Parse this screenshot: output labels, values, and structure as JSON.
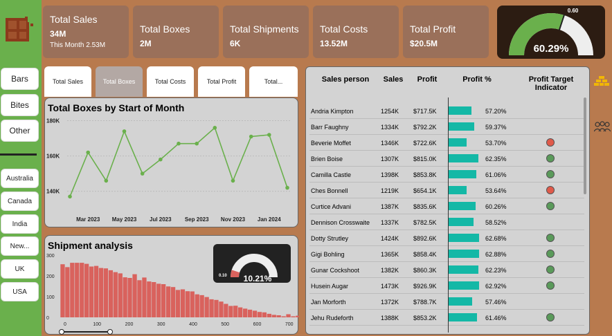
{
  "colors": {
    "green": "#6ab04c",
    "brown": "#b87a4e",
    "kpi": "#9a705a",
    "teal": "#14b8a6",
    "red_dot": "#e05a4a",
    "green_dot": "#5a9a5a",
    "bar_red": "#d9625d",
    "line": "#6ab04c"
  },
  "sidebar": {
    "logo_icon": "chocolate-icon",
    "products": [
      "Bars",
      "Bites",
      "Other"
    ],
    "countries": [
      "Australia",
      "Canada",
      "India",
      "New...",
      "UK",
      "USA"
    ]
  },
  "kpis": [
    {
      "title": "Total Sales",
      "value": "34M",
      "sub": "This Month 2.53M"
    },
    {
      "title": "Total Boxes",
      "value": "2M"
    },
    {
      "title": "Total Shipments",
      "value": "6K"
    },
    {
      "title": "Total Costs",
      "value": "13.52M"
    },
    {
      "title": "Total Profit",
      "value": "$20.5M"
    }
  ],
  "profit_gauge": {
    "value_label": "60.29%",
    "target_label": "0.60",
    "value": 0.6029,
    "target": 0.6
  },
  "tabs": [
    "Total Sales",
    "Total Boxes",
    "Total Costs",
    "Total Profit",
    "Total..."
  ],
  "line_chart": {
    "title": "Total Boxes by Start of Month"
  },
  "shipment": {
    "title": "Shipment analysis",
    "gauge_value_label": "10.21%",
    "gauge_target_label": "0.10",
    "gauge_value": 0.1021
  },
  "table": {
    "headers": [
      "Sales person",
      "Sales",
      "Profit",
      "Profit %",
      "Profit Target Indicator"
    ],
    "rows": [
      {
        "name": "Andria Kimpton",
        "sales": "1254K",
        "profit": "$717.5K",
        "pct": "57.20%",
        "p": 57.2,
        "ind": ""
      },
      {
        "name": "Barr Faughny",
        "sales": "1334K",
        "profit": "$792.2K",
        "pct": "59.37%",
        "p": 59.37,
        "ind": ""
      },
      {
        "name": "Beverie Moffet",
        "sales": "1346K",
        "profit": "$722.6K",
        "pct": "53.70%",
        "p": 53.7,
        "ind": "red"
      },
      {
        "name": "Brien Boise",
        "sales": "1307K",
        "profit": "$815.0K",
        "pct": "62.35%",
        "p": 62.35,
        "ind": "green"
      },
      {
        "name": "Camilla Castle",
        "sales": "1398K",
        "profit": "$853.8K",
        "pct": "61.06%",
        "p": 61.06,
        "ind": "green"
      },
      {
        "name": "Ches Bonnell",
        "sales": "1219K",
        "profit": "$654.1K",
        "pct": "53.64%",
        "p": 53.64,
        "ind": "red"
      },
      {
        "name": "Curtice Advani",
        "sales": "1387K",
        "profit": "$835.6K",
        "pct": "60.26%",
        "p": 60.26,
        "ind": "green"
      },
      {
        "name": "Dennison Crosswaite",
        "sales": "1337K",
        "profit": "$782.5K",
        "pct": "58.52%",
        "p": 58.52,
        "ind": ""
      },
      {
        "name": "Dotty Strutley",
        "sales": "1424K",
        "profit": "$892.6K",
        "pct": "62.68%",
        "p": 62.68,
        "ind": "green"
      },
      {
        "name": "Gigi Bohling",
        "sales": "1365K",
        "profit": "$858.4K",
        "pct": "62.88%",
        "p": 62.88,
        "ind": "green"
      },
      {
        "name": "Gunar Cockshoot",
        "sales": "1382K",
        "profit": "$860.3K",
        "pct": "62.23%",
        "p": 62.23,
        "ind": "green"
      },
      {
        "name": "Husein Augar",
        "sales": "1473K",
        "profit": "$926.9K",
        "pct": "62.92%",
        "p": 62.92,
        "ind": "green"
      },
      {
        "name": "Jan Morforth",
        "sales": "1372K",
        "profit": "$788.7K",
        "pct": "57.46%",
        "p": 57.46,
        "ind": ""
      },
      {
        "name": "Jehu Rudeforth",
        "sales": "1388K",
        "profit": "$853.2K",
        "pct": "61.46%",
        "p": 61.46,
        "ind": "green"
      }
    ]
  },
  "right_icons": [
    "coins-icon",
    "people-icon"
  ],
  "chart_data": [
    {
      "type": "line",
      "title": "Total Boxes by Start of Month",
      "x": [
        "2023-02",
        "2023-03",
        "2023-04",
        "2023-05",
        "2023-06",
        "2023-07",
        "2023-08",
        "2023-09",
        "2023-10",
        "2023-11",
        "2023-12",
        "2024-01",
        "2024-02"
      ],
      "values": [
        137,
        162,
        146,
        174,
        150,
        158,
        167,
        167,
        176,
        146,
        171,
        172,
        142
      ],
      "x_tick_labels": [
        "Mar 2023",
        "May 2023",
        "Jul 2023",
        "Sep 2023",
        "Nov 2023",
        "Jan 2024"
      ],
      "y_tick_labels": [
        "140K",
        "160K",
        "180K"
      ],
      "ylim": [
        134,
        181
      ],
      "unit": "K"
    },
    {
      "type": "bar",
      "title": "Shipment analysis",
      "x_tick_labels": [
        "0",
        "100",
        "200",
        "300",
        "400",
        "500",
        "600",
        "700"
      ],
      "y_tick_labels": [
        "0",
        "100",
        "200",
        "300"
      ],
      "ylim": [
        0,
        300
      ],
      "xlim": [
        -15,
        720
      ],
      "bin_width": 15,
      "values": [
        256,
        242,
        263,
        263,
        263,
        258,
        245,
        248,
        238,
        236,
        227,
        218,
        212,
        193,
        190,
        208,
        179,
        192,
        173,
        170,
        162,
        160,
        149,
        146,
        132,
        135,
        126,
        125,
        111,
        107,
        98,
        87,
        84,
        76,
        65,
        55,
        56,
        48,
        42,
        37,
        32,
        26,
        24,
        17,
        12,
        10,
        5,
        15,
        5,
        8
      ]
    }
  ]
}
